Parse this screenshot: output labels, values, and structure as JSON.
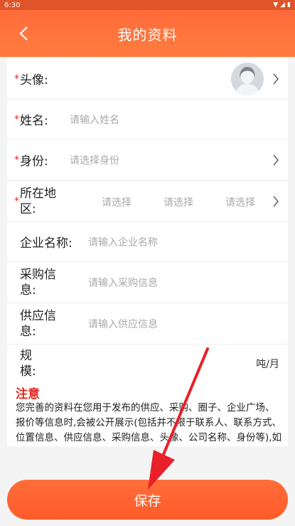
{
  "status_bar": {
    "time": "6:30"
  },
  "header": {
    "title": "我的资料"
  },
  "form": {
    "avatar": {
      "label": "头像:"
    },
    "name": {
      "label": "姓名:",
      "placeholder": "请输入姓名"
    },
    "identity": {
      "label": "身份:",
      "placeholder": "请选择身份"
    },
    "region": {
      "label_line1": "所在地",
      "label_line2": "区:",
      "options": [
        "请选择",
        "请选择",
        "请选择"
      ]
    },
    "company": {
      "label": "企业名称:",
      "placeholder": "请输入企业名称"
    },
    "purchase": {
      "label_line1": "采购信",
      "label_line2": "息:",
      "placeholder": "请输入采购信息"
    },
    "supply": {
      "label_line1": "供应信",
      "label_line2": "息:",
      "placeholder": "请输入供应信息"
    },
    "scale": {
      "label_line1": "规",
      "label_line2": "模:",
      "unit": "吨/月"
    },
    "required_mark": "*"
  },
  "notice": {
    "title": "注意",
    "body": "您完善的资料在您用于发布的供应、采购、圈子、企业广场、报价等信息时,会被公开展示(包括并不限于联系人、联系方式、位置信息、供应信息、采购信息、头像、公司名称、身份等),如您同意,请继续点击完善。信息发布成功即代表同意。如您不同意请"
  },
  "footer": {
    "save_label": "保存"
  },
  "colors": {
    "accent": "#ff6a3a",
    "required": "#e3281d",
    "placeholder": "#a9a9a9"
  }
}
